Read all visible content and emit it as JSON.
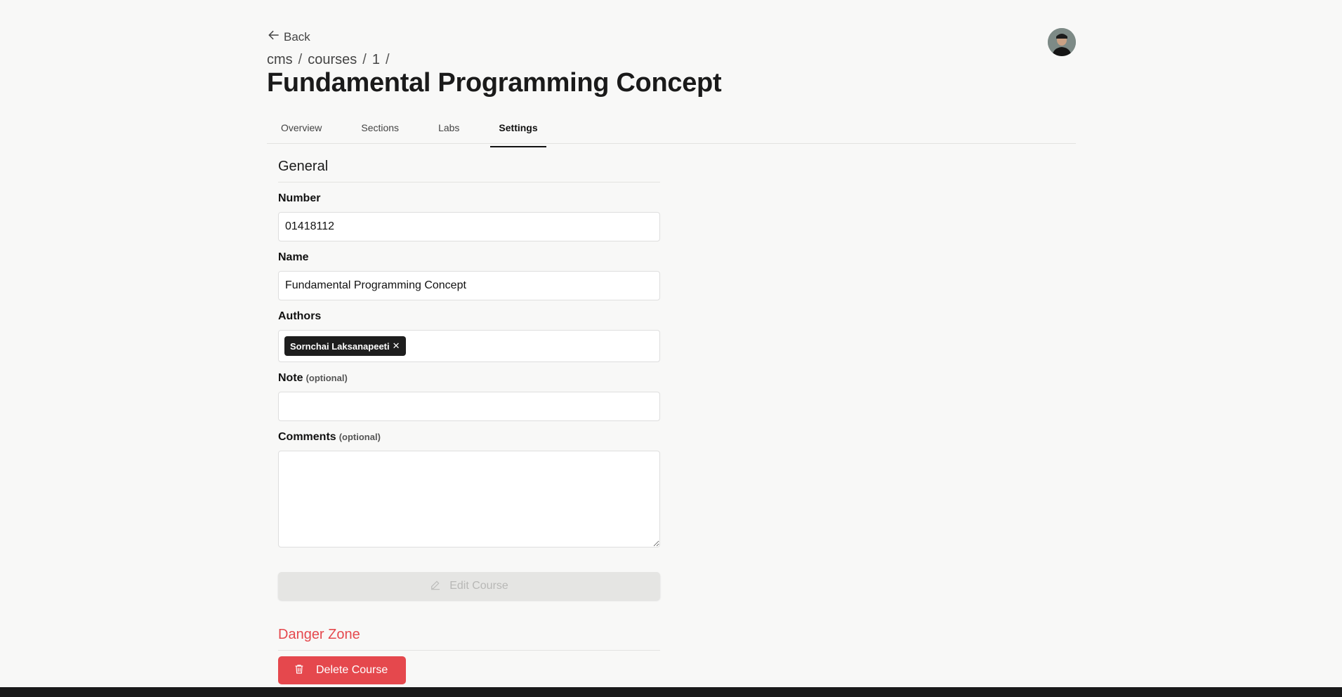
{
  "header": {
    "back_label": "Back",
    "breadcrumb": [
      "cms",
      "courses",
      "1"
    ],
    "title": "Fundamental Programming Concept"
  },
  "tabs": [
    {
      "label": "Overview",
      "active": false
    },
    {
      "label": "Sections",
      "active": false
    },
    {
      "label": "Labs",
      "active": false
    },
    {
      "label": "Settings",
      "active": true
    }
  ],
  "general": {
    "section_title": "General",
    "number_label": "Number",
    "number_value": "01418112",
    "name_label": "Name",
    "name_value": "Fundamental Programming Concept",
    "authors_label": "Authors",
    "authors": [
      {
        "name": "Sornchai Laksanapeeti",
        "remove": "✕"
      }
    ],
    "note_label": "Note",
    "note_optional": "(optional)",
    "note_value": "",
    "comments_label": "Comments",
    "comments_optional": "(optional)",
    "comments_value": "",
    "edit_button": "Edit Course"
  },
  "danger": {
    "section_title": "Danger Zone",
    "delete_button": "Delete Course"
  },
  "colors": {
    "accent_danger": "#e5484d",
    "chip_bg": "#1e1e1e",
    "page_bg": "#f8f8f7"
  }
}
